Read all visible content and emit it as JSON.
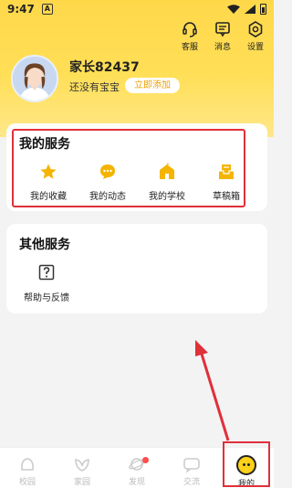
{
  "status_bar": {
    "time": "9:47",
    "notification_letter": "A"
  },
  "header": {
    "actions": [
      {
        "label": "客服",
        "icon": "headset-icon"
      },
      {
        "label": "消息",
        "icon": "message-icon"
      },
      {
        "label": "设置",
        "icon": "gear-icon"
      }
    ],
    "user": {
      "name": "家长82437",
      "no_child_text": "还没有宝宝",
      "add_button": "立即添加"
    }
  },
  "my_services": {
    "title": "我的服务",
    "items": [
      {
        "label": "我的收藏",
        "icon": "star-icon"
      },
      {
        "label": "我的动态",
        "icon": "chat-bubble-icon"
      },
      {
        "label": "我的学校",
        "icon": "school-icon"
      },
      {
        "label": "草稿箱",
        "icon": "draft-box-icon"
      }
    ]
  },
  "other_services": {
    "title": "其他服务",
    "items": [
      {
        "label": "帮助与反馈",
        "icon": "help-icon"
      }
    ]
  },
  "tabbar": {
    "items": [
      {
        "label": "校园",
        "icon": "campus-icon"
      },
      {
        "label": "家园",
        "icon": "home-leaf-icon"
      },
      {
        "label": "发现",
        "icon": "planet-icon"
      },
      {
        "label": "交流",
        "icon": "chat-icon"
      },
      {
        "label": "我的",
        "icon": "mine-face-icon"
      }
    ],
    "active": "我的"
  },
  "colors": {
    "accent": "#ffd84a",
    "highlight": "#e0303a",
    "service_icon": "#f4b400"
  }
}
